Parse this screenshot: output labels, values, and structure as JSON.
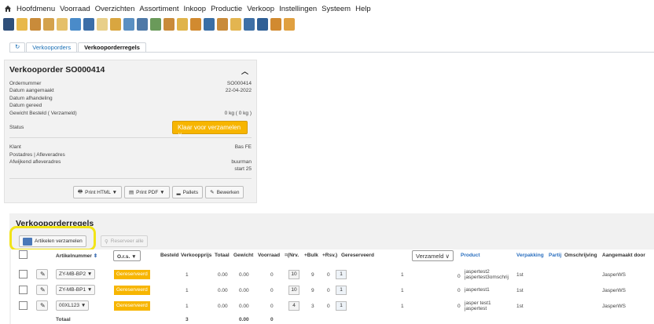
{
  "menu": {
    "items": [
      "Hoofdmenu",
      "Voorraad",
      "Overzichten",
      "Assortiment",
      "Inkoop",
      "Productie",
      "Verkoop",
      "Instellingen",
      "Systeem",
      "Help"
    ]
  },
  "toolbar_icons": [
    "report-icon",
    "document-icon",
    "tools-icon",
    "truck-icon",
    "box-icon",
    "calendar-icon",
    "globe-icon",
    "document-icon",
    "box-icon",
    "globe-icon",
    "search-icon",
    "people-icon",
    "tools-icon",
    "document-icon",
    "tools-icon",
    "document-icon",
    "tools-icon",
    "document-icon",
    "tools-icon",
    "document-icon",
    "tools-icon",
    "user-icon"
  ],
  "tabs": [
    "Verkooporders",
    "Verkooporderregels"
  ],
  "order": {
    "title": "Verkooporder SO000414",
    "fields": [
      {
        "label": "Ordernummer",
        "value": "SO000414"
      },
      {
        "label": "Datum aangemaakt",
        "value": "22-04-2022"
      },
      {
        "label": "Datum afhandeling",
        "value": ""
      },
      {
        "label": "Datum gereed",
        "value": ""
      },
      {
        "label": "Gewicht Besteld ( Verzameld)",
        "value": "0 kg ( 0 kg )"
      }
    ],
    "status_label": "Status",
    "status_value": "Klaar voor verzamelen",
    "klant_label": "Klant",
    "klant_value": "Bas FE",
    "postadres_label": "Postadres | Afleveradres",
    "afwijkend_label": "Afwijkend afleveradres",
    "afwijkend_value1": "buurman",
    "afwijkend_value2": "start 25",
    "buttons": {
      "print_html": "Print HTML ▼",
      "print_pdf": "Print PDF ▼",
      "pallets": "Pallets",
      "bewerken": "Bewerken"
    }
  },
  "regels": {
    "title": "Verkooporderregels",
    "btn_verzamelen": "Artikelen verzamelen",
    "btn_reserveer": "Reserveer alle",
    "headers": {
      "artikelnummer": "Artikelnummer",
      "ors": "O.r.s. ▼",
      "besteld": "Besteld",
      "verkoopprijs": "Verkoopprijs",
      "totaal": "Totaal",
      "gewicht": "Gewicht",
      "voorraad": "Voorraad",
      "nrv": "=(Nrv.",
      "bulk": "+Bulk",
      "rsv": "+Rsv.)",
      "gereserveerd": "Gereserveerd",
      "verzameld": "Verzameld",
      "product": "Product",
      "verpakking": "Verpakking",
      "partij": "Partij",
      "omschrijving": "Omschrijving",
      "aangemaakt": "Aangemaakt door"
    },
    "rows": [
      {
        "art": "ZY-MB-BP2 ▼",
        "ors": "Gereserveerd",
        "besteld": "1",
        "prijs": "0.00",
        "totaal": "0.00",
        "gewicht": "0",
        "voorraad": "10",
        "nrv": "9",
        "bulk": "0",
        "rsv": "1",
        "gereserveerd": "1",
        "verzameld": "0",
        "product1": "jaspertest2",
        "product2": "jaspertest3omschrijving",
        "verpakking": "1st",
        "door": "JasperWS"
      },
      {
        "art": "ZY-MB-BP1 ▼",
        "ors": "Gereserveerd",
        "besteld": "1",
        "prijs": "0.00",
        "totaal": "0.00",
        "gewicht": "0",
        "voorraad": "10",
        "nrv": "9",
        "bulk": "0",
        "rsv": "1",
        "gereserveerd": "1",
        "verzameld": "0",
        "product1": "jaspertest1",
        "product2": "",
        "verpakking": "1st",
        "door": "JasperWS"
      },
      {
        "art": "00XL123 ▼",
        "ors": "Gereserveerd",
        "besteld": "1",
        "prijs": "0.00",
        "totaal": "0.00",
        "gewicht": "0",
        "voorraad": "4",
        "nrv": "3",
        "bulk": "0",
        "rsv": "1",
        "gereserveerd": "1",
        "verzameld": "0",
        "product1": "jasper test1",
        "product2": "jaspertest",
        "verpakking": "1st",
        "door": "JasperWS"
      }
    ],
    "totals": {
      "label": "Totaal",
      "besteld": "3",
      "totaal": "0.00",
      "gewicht": "0"
    }
  },
  "colors": {
    "accent": "#f7b500",
    "link": "#1a6fb5",
    "highlight": "#f2e416"
  }
}
